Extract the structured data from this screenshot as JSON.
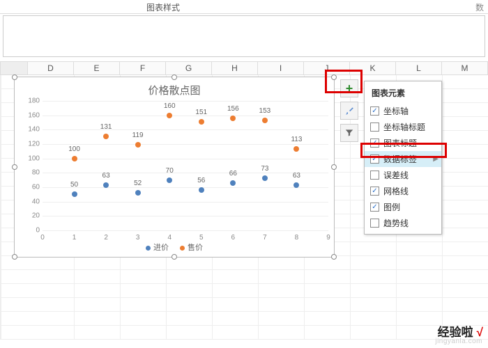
{
  "ribbon": {
    "group_label": "图表样式",
    "right_truncated": "数"
  },
  "columns": [
    "",
    "D",
    "E",
    "F",
    "G",
    "H",
    "I",
    "J",
    "K",
    "L",
    "M"
  ],
  "chart": {
    "title": "价格散点图",
    "legend": {
      "series1": "进价",
      "series2": "售价"
    }
  },
  "chart_data": {
    "type": "scatter",
    "title": "价格散点图",
    "xlabel": "",
    "ylabel": "",
    "xlim": [
      0,
      9
    ],
    "ylim": [
      0,
      180
    ],
    "x_ticks": [
      0,
      1,
      2,
      3,
      4,
      5,
      6,
      7,
      8,
      9
    ],
    "y_ticks": [
      0,
      20,
      40,
      60,
      80,
      100,
      120,
      140,
      160,
      180
    ],
    "x": [
      1,
      2,
      3,
      4,
      5,
      6,
      7,
      8
    ],
    "series": [
      {
        "name": "进价",
        "color": "#4f81bd",
        "values": [
          50,
          63,
          52,
          70,
          56,
          66,
          73,
          63
        ]
      },
      {
        "name": "售价",
        "color": "#ed7d31",
        "values": [
          100,
          131,
          119,
          160,
          151,
          156,
          153,
          113
        ]
      }
    ],
    "grid": true,
    "legend_position": "bottom",
    "data_labels": true
  },
  "side_buttons": {
    "plus": "+",
    "brush": "brush-icon",
    "filter": "funnel-icon"
  },
  "flyout": {
    "title": "图表元素",
    "items": [
      {
        "label": "坐标轴",
        "checked": true,
        "selected": false
      },
      {
        "label": "坐标轴标题",
        "checked": false,
        "selected": false
      },
      {
        "label": "图表标题",
        "checked": true,
        "selected": false
      },
      {
        "label": "数据标签",
        "checked": true,
        "selected": true,
        "submenu": true
      },
      {
        "label": "误差线",
        "checked": false,
        "selected": false
      },
      {
        "label": "网格线",
        "checked": true,
        "selected": false
      },
      {
        "label": "图例",
        "checked": true,
        "selected": false
      },
      {
        "label": "趋势线",
        "checked": false,
        "selected": false
      }
    ]
  },
  "watermark": {
    "brand": "经验啦",
    "mark": "√",
    "url": "jingyanla.com"
  }
}
